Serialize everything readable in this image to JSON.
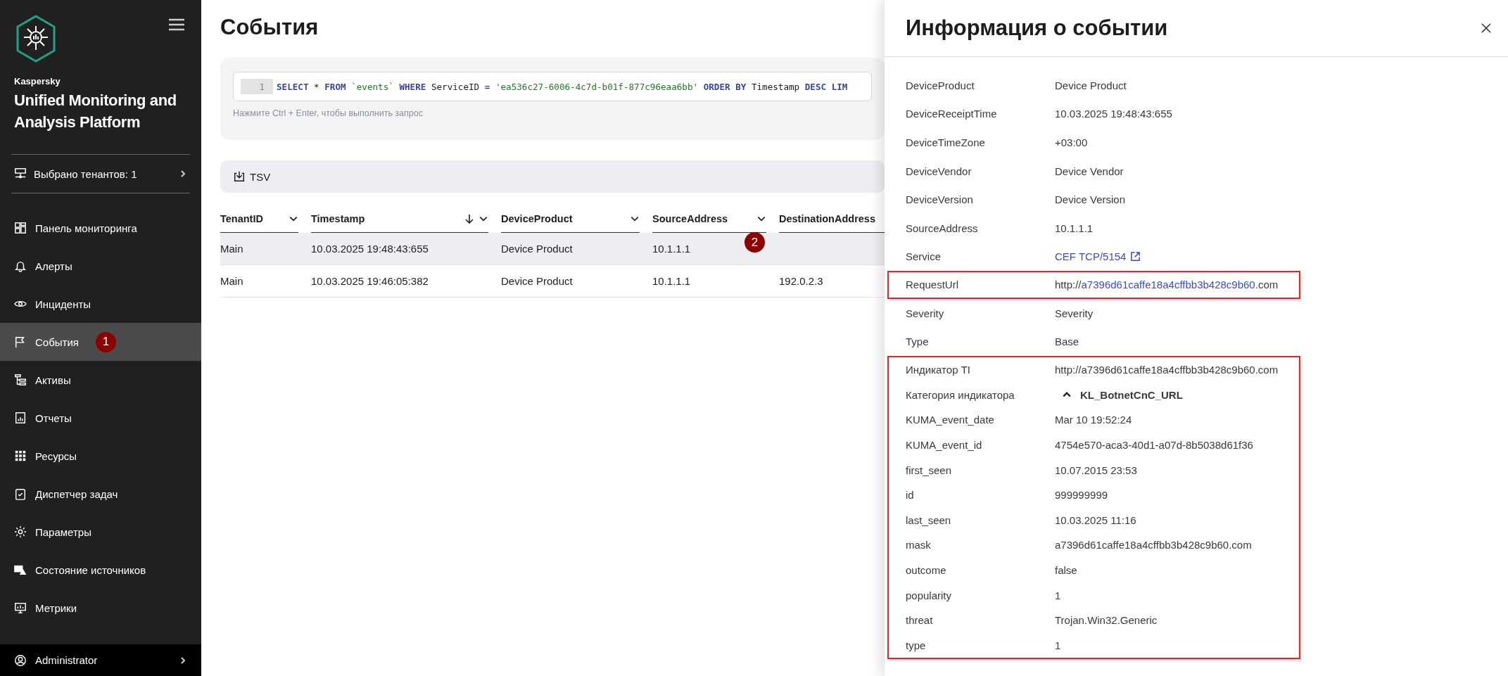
{
  "sidebar": {
    "brand": "Kaspersky",
    "product": "Unified Monitoring and Analysis Platform",
    "tenants": "Выбрано тенантов: 1",
    "items": [
      {
        "label": "Панель мониторинга",
        "selected": false
      },
      {
        "label": "Алерты",
        "selected": false
      },
      {
        "label": "Инциденты",
        "selected": false
      },
      {
        "label": "События",
        "selected": true,
        "badge": "1"
      },
      {
        "label": "Активы",
        "selected": false
      },
      {
        "label": "Отчеты",
        "selected": false
      },
      {
        "label": "Ресурсы",
        "selected": false
      },
      {
        "label": "Диспетчер задач",
        "selected": false
      },
      {
        "label": "Параметры",
        "selected": false
      },
      {
        "label": "Состояние источников",
        "selected": false
      },
      {
        "label": "Метрики",
        "selected": false
      }
    ],
    "user": "Administrator"
  },
  "page": {
    "title": "События",
    "query": {
      "line_number": "1",
      "tokens": [
        {
          "kind": "keyword",
          "text": "SELECT"
        },
        {
          "kind": "plain",
          "text": " * "
        },
        {
          "kind": "keyword",
          "text": "FROM"
        },
        {
          "kind": "string",
          "text": " `events` "
        },
        {
          "kind": "keyword",
          "text": "WHERE"
        },
        {
          "kind": "plain",
          "text": " ServiceID "
        },
        {
          "kind": "keyword",
          "text": "="
        },
        {
          "kind": "string",
          "text": " 'ea536c27-6006-4c7d-b01f-877c96eaa6bb' "
        },
        {
          "kind": "keyword",
          "text": "ORDER BY"
        },
        {
          "kind": "plain",
          "text": " Timestamp "
        },
        {
          "kind": "keyword",
          "text": "DESC LIM"
        }
      ],
      "hint": "Нажмите Ctrl + Enter, чтобы выполнить запрос"
    },
    "export_button": "TSV",
    "table": {
      "columns": [
        {
          "label": "TenantID",
          "sorted": false,
          "menu": true
        },
        {
          "label": "Timestamp",
          "sorted": true,
          "menu": true
        },
        {
          "label": "DeviceProduct",
          "sorted": false,
          "menu": true
        },
        {
          "label": "SourceAddress",
          "sorted": false,
          "menu": true
        },
        {
          "label": "DestinationAddress",
          "sorted": false,
          "menu": false
        }
      ],
      "rows": [
        {
          "selected": true,
          "badge": "2",
          "cells": [
            "Main",
            "10.03.2025 19:48:43:655",
            "Device Product",
            "10.1.1.1",
            ""
          ]
        },
        {
          "selected": false,
          "cells": [
            "Main",
            "10.03.2025 19:46:05:382",
            "Device Product",
            "10.1.1.1",
            "192.0.2.3"
          ]
        }
      ]
    }
  },
  "details_panel": {
    "title": "Информация о событии",
    "groups": [
      {
        "highlighted": false,
        "rows": [
          {
            "kind": "text",
            "label": "DeviceProduct",
            "value": "Device Product"
          },
          {
            "kind": "text",
            "label": "DeviceReceiptTime",
            "value": "10.03.2025 19:48:43:655"
          },
          {
            "kind": "text",
            "label": "DeviceTimeZone",
            "value": "+03:00"
          },
          {
            "kind": "text",
            "label": "DeviceVendor",
            "value": "Device Vendor"
          },
          {
            "kind": "text",
            "label": "DeviceVersion",
            "value": "Device Version"
          },
          {
            "kind": "text",
            "label": "SourceAddress",
            "value": "10.1.1.1"
          },
          {
            "kind": "link",
            "label": "Service",
            "value": "CEF TCP/5154"
          }
        ]
      },
      {
        "highlighted": true,
        "rows": [
          {
            "kind": "url",
            "label": "RequestUrl",
            "prefix": "http://",
            "link": "a7396d61caffe18a4cffbb3b428c9b60",
            "suffix": ".com"
          }
        ]
      },
      {
        "highlighted": false,
        "rows": [
          {
            "kind": "text",
            "label": "Severity",
            "value": "Severity"
          },
          {
            "kind": "text",
            "label": "Type",
            "value": "Base"
          }
        ]
      },
      {
        "highlighted": true,
        "rows": [
          {
            "kind": "text",
            "label": "Индикатор TI",
            "value": "http://a7396d61caffe18a4cffbb3b428c9b60.com"
          },
          {
            "kind": "category",
            "label": "Категория индикатора",
            "value": "KL_BotnetCnC_URL",
            "expanded": true
          },
          {
            "kind": "text",
            "label": "KUMA_event_date",
            "value": "Mar 10 19:52:24"
          },
          {
            "kind": "text",
            "label": "KUMA_event_id",
            "value": "4754e570-aca3-40d1-a07d-8b5038d61f36"
          },
          {
            "kind": "text",
            "label": "first_seen",
            "value": "10.07.2015 23:53"
          },
          {
            "kind": "text",
            "label": "id",
            "value": "999999999"
          },
          {
            "kind": "text",
            "label": "last_seen",
            "value": "10.03.2025 11:16"
          },
          {
            "kind": "text",
            "label": "mask",
            "value": "a7396d61caffe18a4cffbb3b428c9b60.com"
          },
          {
            "kind": "text",
            "label": "outcome",
            "value": "false"
          },
          {
            "kind": "text",
            "label": "popularity",
            "value": "1"
          },
          {
            "kind": "text",
            "label": "threat",
            "value": "Trojan.Win32.Generic"
          },
          {
            "kind": "text",
            "label": "type",
            "value": "1"
          }
        ]
      }
    ]
  }
}
